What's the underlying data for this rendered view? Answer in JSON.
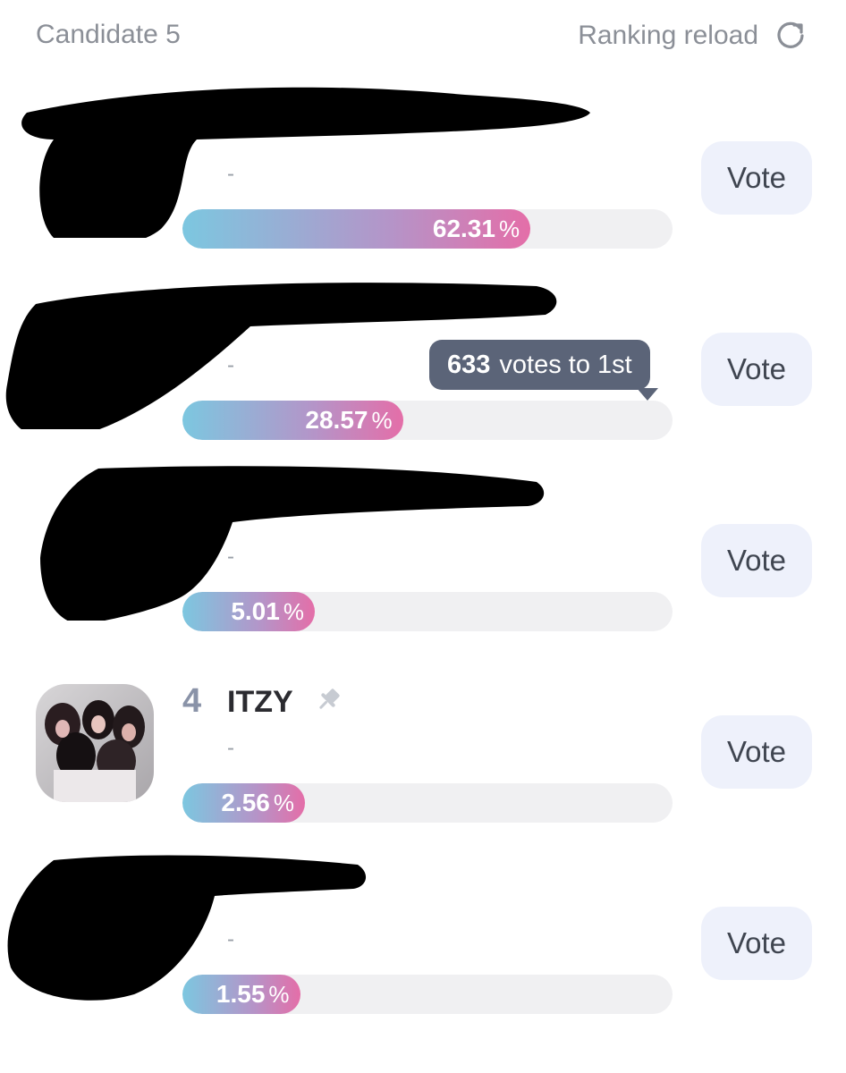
{
  "header": {
    "candidate_label": "Candidate 5",
    "reload_label": "Ranking reload",
    "reload_icon": "refresh-icon"
  },
  "entries": [
    {
      "rank": "",
      "name": "",
      "subtitle": "-",
      "percent": "62.31",
      "percent_value": 62.31,
      "vote_label": "Vote",
      "redacted": true
    },
    {
      "rank": "",
      "name": "",
      "subtitle": "-",
      "percent": "28.57",
      "percent_value": 28.57,
      "vote_label": "Vote",
      "redacted": true,
      "tooltip": {
        "count": "633",
        "text": "votes to 1st"
      }
    },
    {
      "rank": "",
      "name": "",
      "subtitle": "-",
      "percent": "5.01",
      "percent_value": 5.01,
      "vote_label": "Vote",
      "redacted": true
    },
    {
      "rank": "4",
      "name": "ITZY",
      "subtitle": "-",
      "percent": "2.56",
      "percent_value": 2.56,
      "vote_label": "Vote",
      "redacted": false,
      "pin_icon": "pin-icon"
    },
    {
      "rank": "",
      "name": "",
      "subtitle": "-",
      "percent": "1.55",
      "percent_value": 1.55,
      "vote_label": "Vote",
      "redacted": true
    }
  ],
  "percent_symbol": "%",
  "colors": {
    "bar_start": "#7cc7e0",
    "bar_end": "#e46ea8",
    "track": "#f0f0f2",
    "vote_button": "#eef1fb",
    "tooltip": "#5b6478"
  }
}
